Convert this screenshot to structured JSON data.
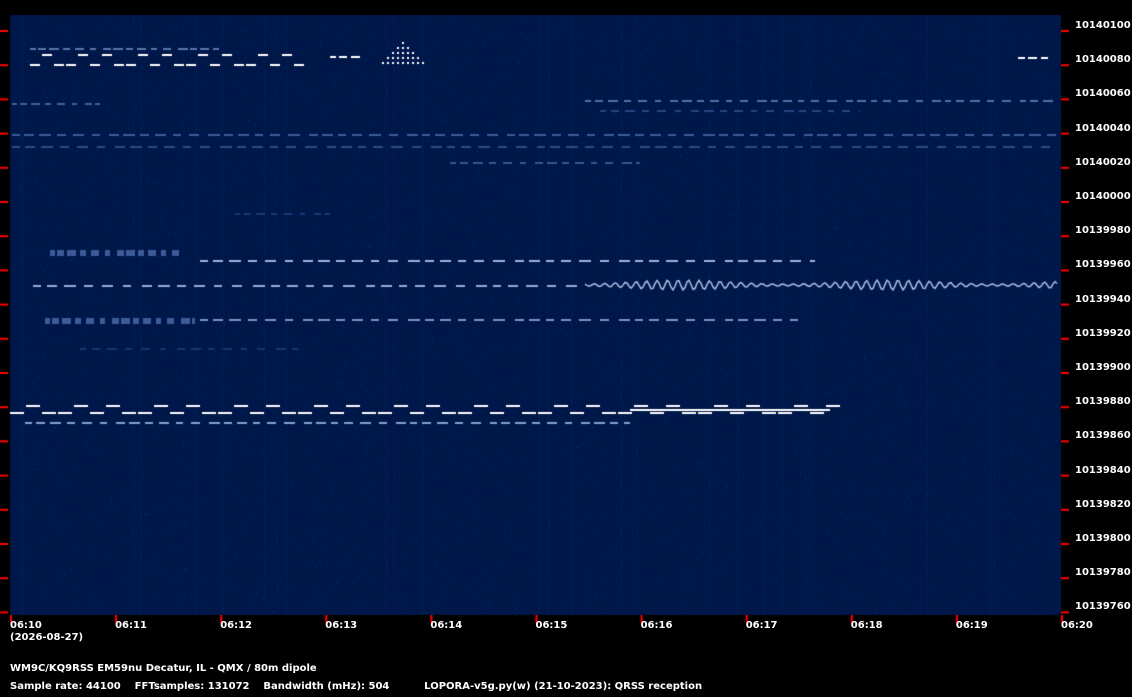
{
  "spectrogram": {
    "colors": {
      "background": "#00174a",
      "trace": "#ffffff",
      "tick": "#ff0000"
    }
  },
  "y_axis": {
    "labels": [
      "10140100",
      "10140080",
      "10140060",
      "10140040",
      "10140020",
      "10140000",
      "10139980",
      "10139960",
      "10139940",
      "10139920",
      "10139900",
      "10139880",
      "10139860",
      "10139840",
      "10139820",
      "10139800",
      "10139780",
      "10139760"
    ]
  },
  "x_axis": {
    "labels": [
      "06:10",
      "06:11",
      "06:12",
      "06:13",
      "06:14",
      "06:15",
      "06:16",
      "06:17",
      "06:18",
      "06:19",
      "06:20"
    ],
    "date": "(2026-08-27)"
  },
  "footer": {
    "station": "WM9C/KQ9RSS EM59nu Decatur, IL - QMX / 80m dipole",
    "settings": "Sample rate: 44100    FFTsamples: 131072    Bandwidth (mHz): 504          LOPORA-v5g.py(w) (21-10-2023): QRSS reception"
  }
}
